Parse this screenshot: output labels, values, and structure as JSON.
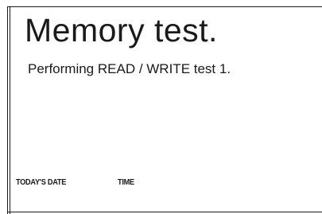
{
  "screen": {
    "title": "Memory test.",
    "status": "Performing READ / WRITE test 1."
  },
  "footer": {
    "date_label": "TODAY'S DATE",
    "time_label": "TIME"
  }
}
